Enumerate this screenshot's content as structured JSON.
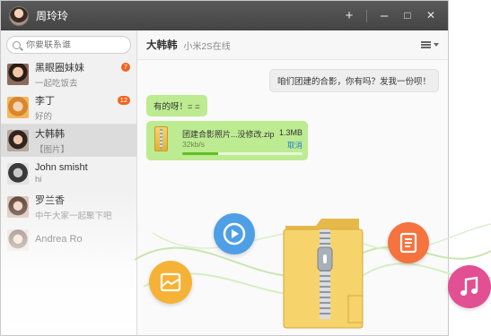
{
  "window": {
    "title": "周玲玲"
  },
  "titlebar": {
    "add_label": "+",
    "minimize_label": "–",
    "maximize_label": "□",
    "close_label": "✕"
  },
  "search": {
    "placeholder": "你要联系谁"
  },
  "contacts": [
    {
      "name": "黑眼圈妹妹",
      "message": "一起吃饭去",
      "badge": "7"
    },
    {
      "name": "李丁",
      "message": "好的",
      "badge": "12"
    },
    {
      "name": "大韩韩",
      "message": "【图片】"
    },
    {
      "name": "John smisht",
      "message": "hi"
    },
    {
      "name": "罗兰香",
      "message": "中午大家一起聚下吧"
    },
    {
      "name": "Andrea Ro",
      "message": ""
    }
  ],
  "chat": {
    "contact_name": "大韩韩",
    "status": "小米2S在线",
    "messages": [
      {
        "text": "咱们团建的合影，你有吗？发我一份呗！"
      },
      {
        "text": "有的呀！= ="
      }
    ],
    "file": {
      "name": "团建合影照片...没修改.zip",
      "size": "1.3MB",
      "speed": "32kb/s",
      "cancel_label": "取消",
      "progress": 0.3
    }
  },
  "icons": [
    "play-icon",
    "document-icon",
    "image-icon",
    "music-icon",
    "folder-zip-icon"
  ],
  "colors": {
    "accent_green": "#bdeb91",
    "badge": "#f0651f",
    "play": "#4f9fe6",
    "doc": "#f4733f",
    "image": "#f5b236",
    "music": "#e24f92"
  }
}
